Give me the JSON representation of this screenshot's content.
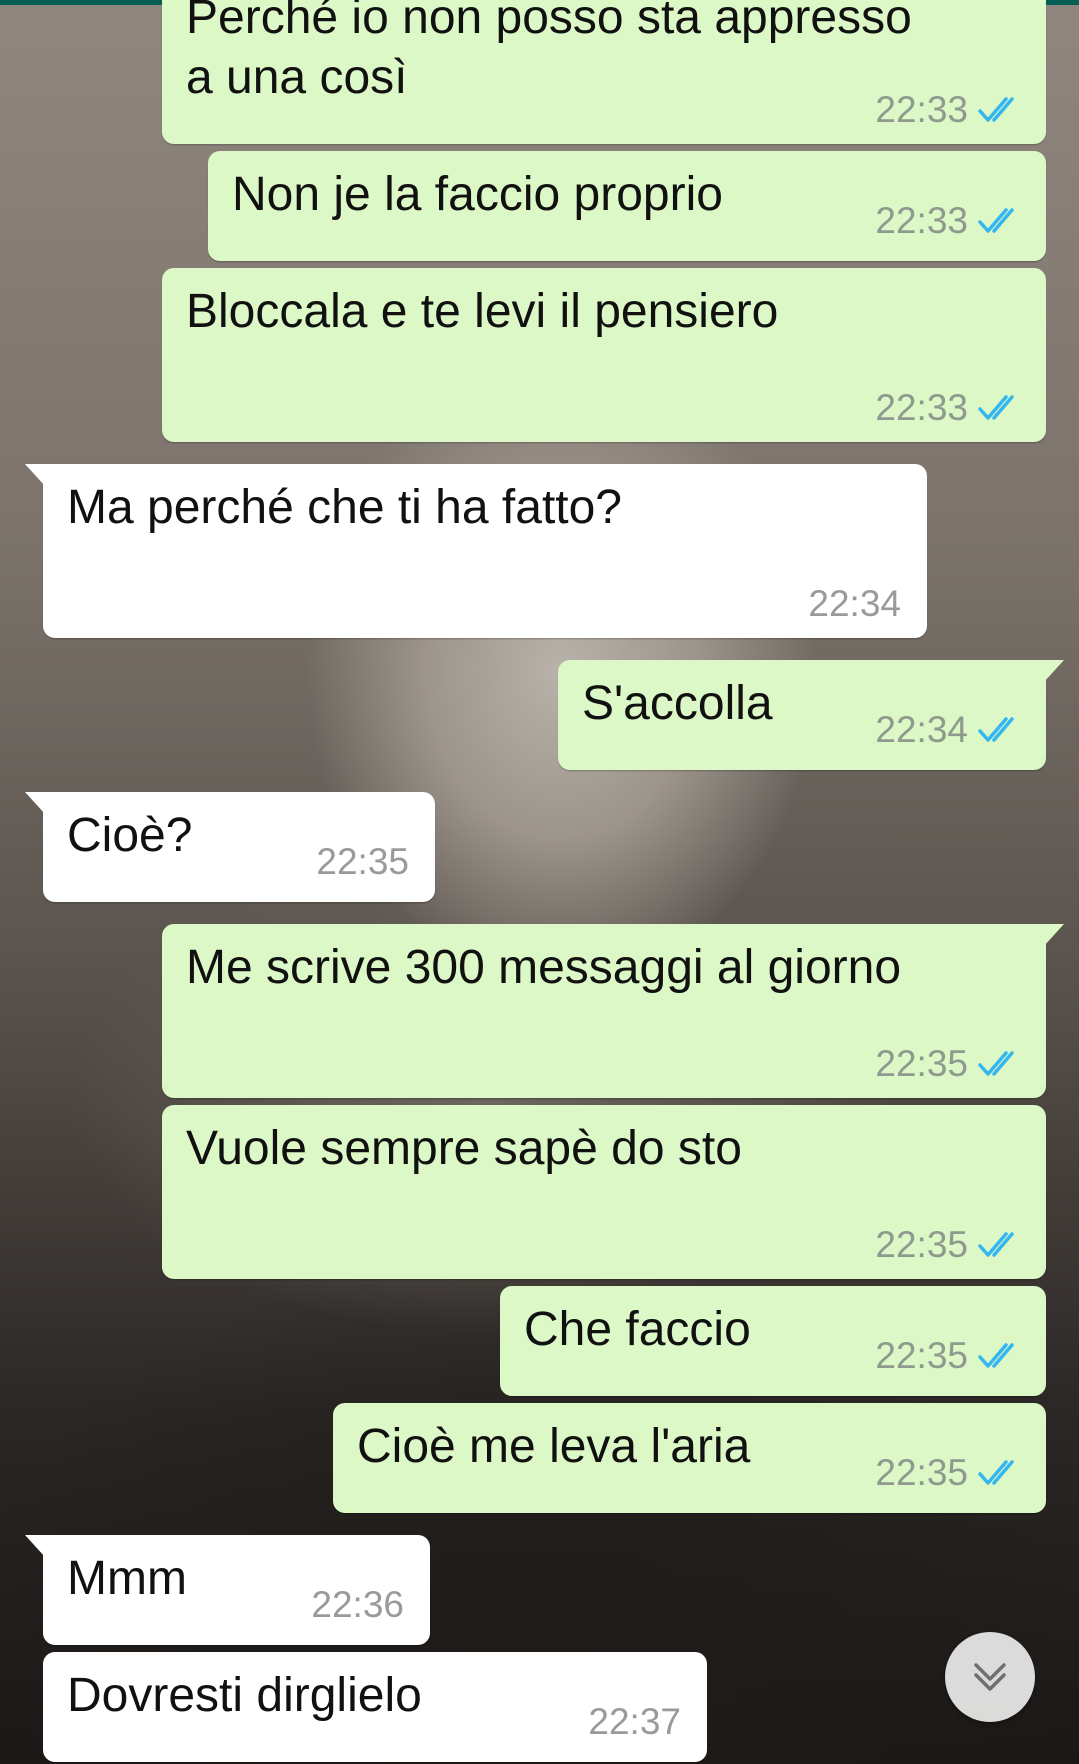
{
  "messages": [
    {
      "direction": "out",
      "text": "Perché io non posso sta appresso\na una così",
      "time": "22:33",
      "status": "read"
    },
    {
      "direction": "out",
      "text": "Non je la faccio proprio",
      "time": "22:33",
      "status": "read"
    },
    {
      "direction": "out",
      "text": "Bloccala e te levi il pensiero",
      "time": "22:33",
      "status": "read"
    },
    {
      "direction": "in",
      "text": "Ma perché che ti ha fatto?",
      "time": "22:34"
    },
    {
      "direction": "out",
      "text": "S'accolla",
      "time": "22:34",
      "status": "read"
    },
    {
      "direction": "in",
      "text": "Cioè?",
      "time": "22:35"
    },
    {
      "direction": "out",
      "text": "Me scrive 300 messaggi al giorno",
      "time": "22:35",
      "status": "read"
    },
    {
      "direction": "out",
      "text": "Vuole sempre sapè do sto",
      "time": "22:35",
      "status": "read"
    },
    {
      "direction": "out",
      "text": "Che faccio",
      "time": "22:35",
      "status": "read"
    },
    {
      "direction": "out",
      "text": "Cioè me leva l'aria",
      "time": "22:35",
      "status": "read"
    },
    {
      "direction": "in",
      "text": "Mmm",
      "time": "22:36"
    },
    {
      "direction": "in",
      "text": "Dovresti dirglielo",
      "time": "22:37"
    }
  ],
  "colors": {
    "outgoing_bubble": "#dcf8c6",
    "incoming_bubble": "#ffffff",
    "read_tick": "#34b7f1",
    "timestamp": "#8e9a8e"
  },
  "icons": {
    "read_receipt": "double-check-icon",
    "scroll_down": "chevron-double-down-icon"
  }
}
